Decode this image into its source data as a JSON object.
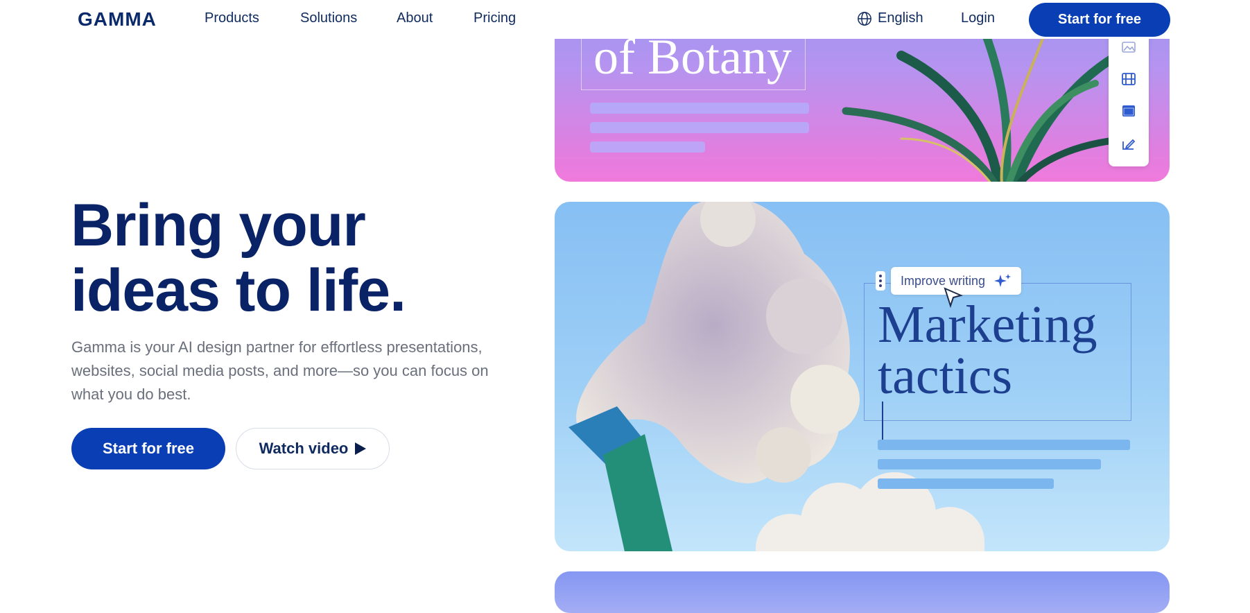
{
  "nav": {
    "logo": "GAMMA",
    "links": [
      "Products",
      "Solutions",
      "About",
      "Pricing"
    ],
    "language": "English",
    "login": "Login",
    "cta": "Start for free"
  },
  "hero": {
    "title_line1": "Bring your",
    "title_line2": "ideas to life.",
    "subtitle": "Gamma is your AI design partner for effortless presentations, websites, social media posts, and more—so you can focus on what you do best.",
    "primary_cta": "Start for free",
    "secondary_cta": "Watch video"
  },
  "card_botany": {
    "title": "of Botany",
    "toolbar_icons": [
      "image-icon",
      "film-icon",
      "window-icon",
      "edit-signature-icon"
    ]
  },
  "card_marketing": {
    "toolbar_label": "Improve writing",
    "title_line1": "Marketing",
    "title_line2": "tactics"
  },
  "colors": {
    "brand_blue": "#0a3eb4",
    "heading_navy": "#0a2366",
    "body_gray": "#6a6f7c"
  }
}
